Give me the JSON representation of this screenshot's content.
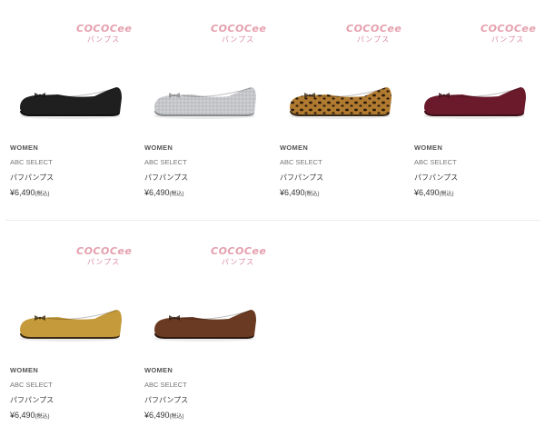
{
  "products": [
    {
      "logo": "COCOCee",
      "logo_sub": "パンプス",
      "gender": "WOMEN",
      "brand": "ABC SELECT",
      "name": "パフパンプス",
      "price": "¥6,490",
      "tax": "(税込)",
      "color": "#1f1f1f",
      "sole": "#111111",
      "pattern": "solid"
    },
    {
      "logo": "COCOCee",
      "logo_sub": "パンプス",
      "gender": "WOMEN",
      "brand": "ABC SELECT",
      "name": "パフパンプス",
      "price": "¥6,490",
      "tax": "(税込)",
      "color": "#c4c6c9",
      "sole": "#8a8c8f",
      "pattern": "glitter"
    },
    {
      "logo": "COCOCee",
      "logo_sub": "パンプス",
      "gender": "WOMEN",
      "brand": "ABC SELECT",
      "name": "パフパンプス",
      "price": "¥6,490",
      "tax": "(税込)",
      "color": "#b07a30",
      "sole": "#3a2a18",
      "pattern": "leopard"
    },
    {
      "logo": "COCOCee",
      "logo_sub": "パンプス",
      "gender": "WOMEN",
      "brand": "ABC SELECT",
      "name": "パフパンプス",
      "price": "¥6,490",
      "tax": "(税込)",
      "color": "#6b1a2c",
      "sole": "#3c0f18",
      "pattern": "solid"
    },
    {
      "logo": "COCOCee",
      "logo_sub": "パンプス",
      "gender": "WOMEN",
      "brand": "ABC SELECT",
      "name": "パフパンプス",
      "price": "¥6,490",
      "tax": "(税込)",
      "color": "#c49a3a",
      "sole": "#3a2a14",
      "pattern": "solid"
    },
    {
      "logo": "COCOCee",
      "logo_sub": "パンプス",
      "gender": "WOMEN",
      "brand": "ABC SELECT",
      "name": "パフパンプス",
      "price": "¥6,490",
      "tax": "(税込)",
      "color": "#6b3a22",
      "sole": "#2e1a10",
      "pattern": "solid"
    }
  ]
}
